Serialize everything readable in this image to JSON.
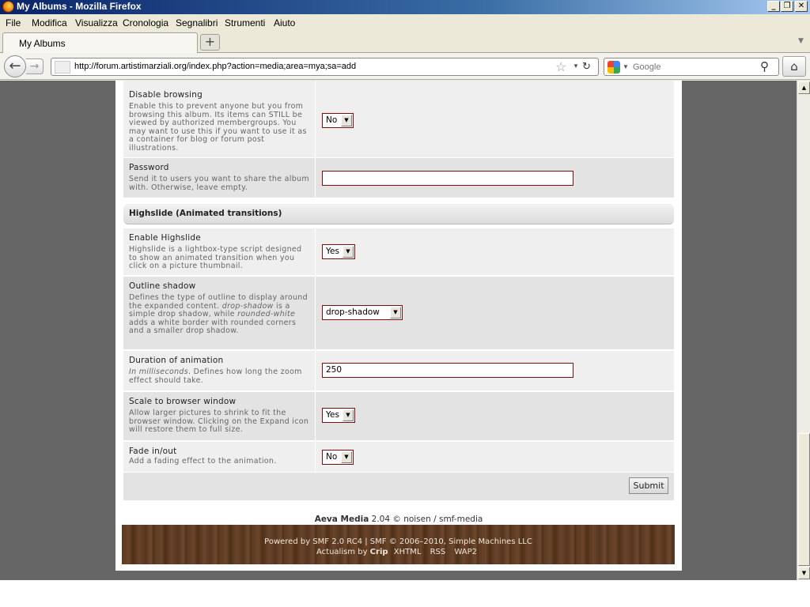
{
  "window": {
    "title": "My Albums - Mozilla Firefox",
    "min": "_",
    "max": "❐",
    "close": "✕"
  },
  "menu": [
    "File",
    "Modifica",
    "Visualizza",
    "Cronologia",
    "Segnalibri",
    "Strumenti",
    "Aiuto"
  ],
  "tab": {
    "label": "My Albums",
    "new": "+"
  },
  "nav": {
    "url": "http://forum.artistimarziali.org/index.php?action=media;area=mya;sa=add",
    "search_placeholder": "Google"
  },
  "form": {
    "rows": [
      {
        "label": "Disable browsing",
        "desc": "Enable this to prevent anyone but you from browsing this album. Its items can STILL be viewed by authorized membergroups. You may want to use this if you want to use it as a container for blog or forum post illustrations.",
        "value": "No"
      },
      {
        "label": "Password",
        "desc": "Send it to users you want to share the album with. Otherwise, leave empty.",
        "value": ""
      },
      {
        "label": "Enable Highslide",
        "desc": "Highslide is a lightbox-type script designed to show an animated transition when you click on a picture thumbnail.",
        "value": "Yes"
      },
      {
        "label": "Outline shadow",
        "desc_html_parts": [
          "Defines the type of outline to display around the expanded content.",
          "drop-shadow",
          " is a simple drop shadow, while ",
          "rounded-white",
          " adds a white border with rounded corners and a smaller drop shadow."
        ],
        "value": "drop-shadow"
      },
      {
        "label": "Duration of animation",
        "desc_parts": [
          "In milliseconds",
          ". Defines how long the zoom effect should take."
        ],
        "value": "250"
      },
      {
        "label": "Scale to browser window",
        "desc": "Allow larger pictures to shrink to fit the browser window. Clicking on the Expand icon will restore them to full size.",
        "value": "Yes"
      },
      {
        "label": "Fade in/out",
        "desc": "Add a fading effect to the animation.",
        "value": "No"
      }
    ],
    "section_header": "Highslide (Animated transitions)",
    "submit": "Submit"
  },
  "credit": {
    "name": "Aeva Media",
    "rest": " 2.04 © noisen / smf-media"
  },
  "footer": {
    "line1": "Powered by SMF 2.0 RC4 | SMF © 2006–2010, Simple Machines LLC",
    "actualism": "Actualism by ",
    "crip": "Crip",
    "links": [
      "XHTML",
      "RSS",
      "WAP2"
    ]
  },
  "colors": {
    "page_bg": "#666666",
    "input_border": "#7d0e0e",
    "footer_wood": "#5a3a22"
  },
  "icons": [
    "firefox-icon",
    "back-arrow-icon",
    "forward-arrow-icon",
    "bookmark-star-icon",
    "reload-icon",
    "google-icon",
    "search-magnifier-icon",
    "home-icon",
    "dropdown-arrow-icon"
  ]
}
